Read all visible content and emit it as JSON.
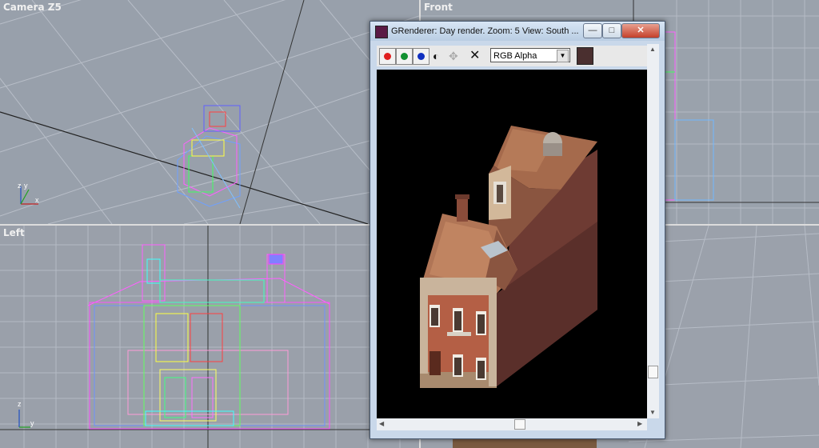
{
  "viewports": {
    "camera": {
      "label": "Camera Z5",
      "axis": [
        "z",
        "y",
        "x"
      ]
    },
    "front": {
      "label": "Front"
    },
    "left": {
      "label": "Left",
      "axis": [
        "z",
        "y"
      ]
    }
  },
  "window": {
    "title": "GRenderer: Day render. Zoom: 5 View: South ...",
    "controls": {
      "minimize": "—",
      "maximize": "□",
      "close": "✕"
    },
    "toolbar": {
      "red_channel": "red",
      "green_channel": "green",
      "blue_channel": "blue",
      "mono_toggle": "◐",
      "split_icon": "✥",
      "clear_icon": "✕",
      "channel_select": "RGB Alpha",
      "swatch_color": "#4a2f2f"
    }
  },
  "colors": {
    "viewport_bg": "#9aa0aa",
    "window_frame": "#c9d8ea",
    "render_bg": "#000000"
  }
}
